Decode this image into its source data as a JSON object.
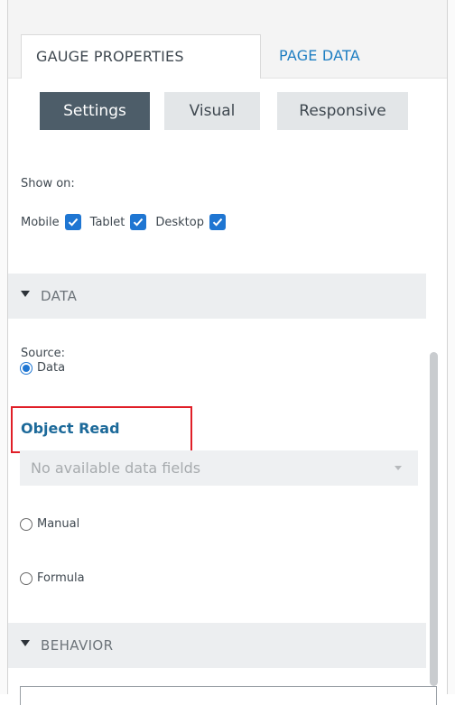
{
  "tabs": [
    {
      "label": "GAUGE PROPERTIES",
      "active": true
    },
    {
      "label": "PAGE DATA",
      "active": false
    }
  ],
  "subtabs": [
    {
      "label": "Settings",
      "active": true
    },
    {
      "label": "Visual",
      "active": false
    },
    {
      "label": "Responsive",
      "active": false
    }
  ],
  "show_on": {
    "label": "Show on:",
    "devices": [
      {
        "label": "Mobile",
        "checked": true
      },
      {
        "label": "Tablet",
        "checked": true
      },
      {
        "label": "Desktop",
        "checked": true
      }
    ]
  },
  "data_section": {
    "title": "DATA",
    "source_label": "Source:",
    "options": [
      {
        "label": "Data",
        "selected": true
      },
      {
        "label": "Manual",
        "selected": false
      },
      {
        "label": "Formula",
        "selected": false
      }
    ],
    "query_name": "Object Read",
    "field_dropdown_value": "No available data fields"
  },
  "behavior_section": {
    "title": "BEHAVIOR"
  },
  "colors": {
    "accent": "#1f76d2",
    "highlight": "#e01f28",
    "active_subtab": "#4d5d69",
    "link": "#1e7ec2"
  }
}
